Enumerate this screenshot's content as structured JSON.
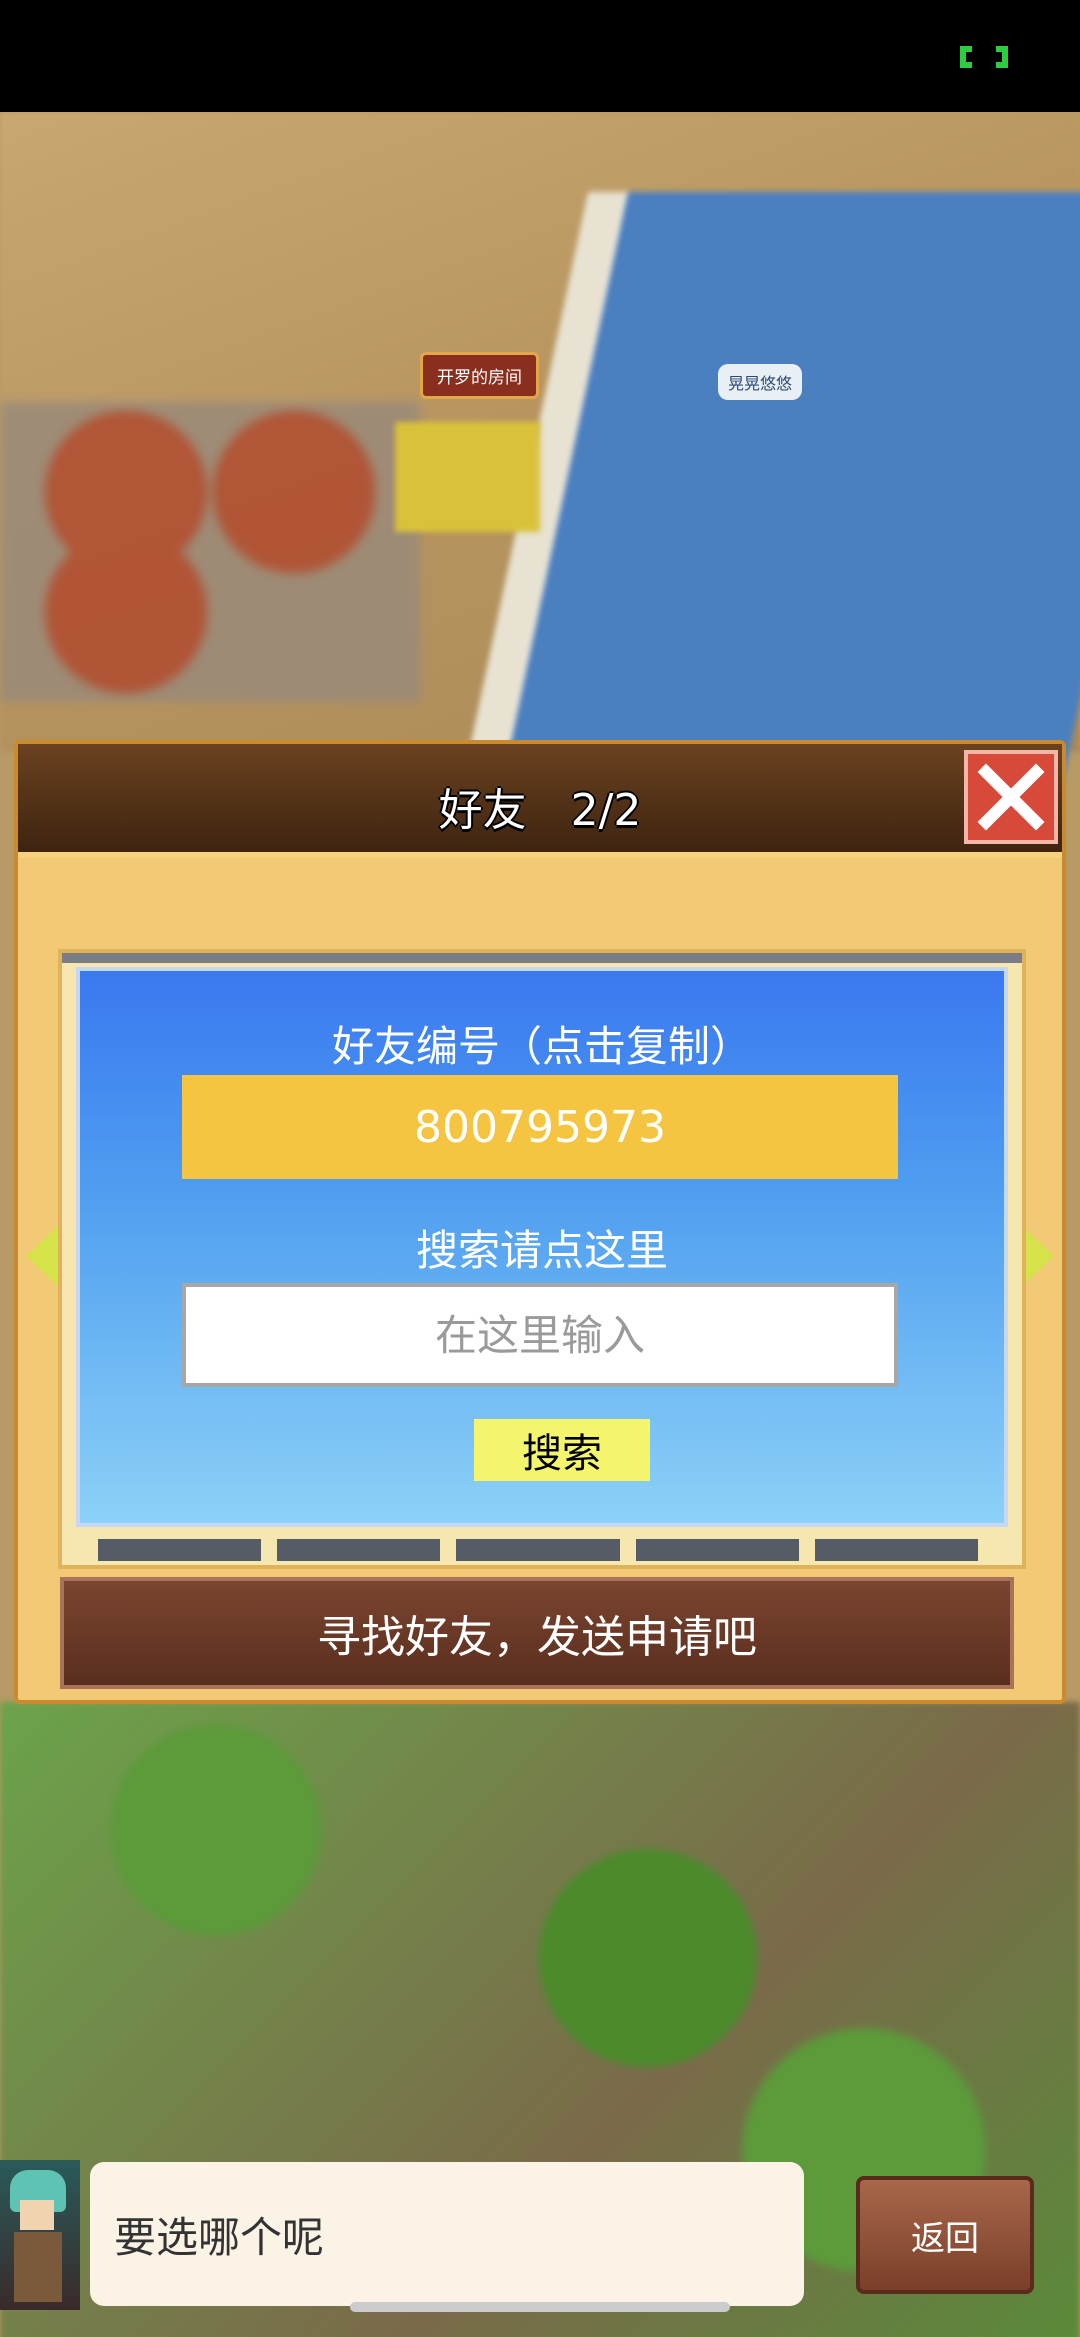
{
  "world": {
    "room_label": "开罗的房间",
    "player_name": "晃晃悠悠"
  },
  "dialog": {
    "title": "好友　2/2",
    "close_icon": "close-x",
    "friend_id_label": "好友编号（点击复制）",
    "friend_id_value": "800795973",
    "search_label": "搜索请点这里",
    "search_placeholder": "在这里输入",
    "search_button": "搜索",
    "find_friends_button": "寻找好友，发送申请吧"
  },
  "bottom": {
    "speech_text": "要选哪个呢",
    "back_button": "返回"
  },
  "colors": {
    "header_brown": "#4e2e16",
    "close_red": "#d74a3a",
    "friend_id_yellow": "#f5c542",
    "search_button_yellow": "#f4f56c",
    "panel_blue": "#3a78f0"
  }
}
